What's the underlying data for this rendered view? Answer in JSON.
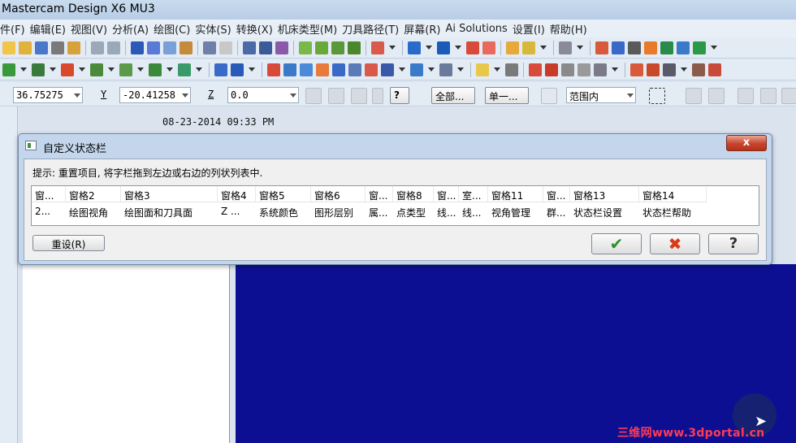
{
  "app": {
    "title": "Mastercam Design X6 MU3"
  },
  "menu": [
    "件(F)",
    "编辑(E)",
    "视图(V)",
    "分析(A)",
    "绘图(C)",
    "实体(S)",
    "转换(X)",
    "机床类型(M)",
    "刀具路径(T)",
    "屏幕(R)",
    "Ai Solutions",
    "设置(I)",
    "帮助(H)"
  ],
  "coords": {
    "x_value": "36.75275",
    "y_label": "Y",
    "y_value": "-20.41258",
    "z_label": "Z",
    "z_value": "0.0",
    "all_button": "全部...",
    "single_button": "单一...",
    "range_value": "范围内"
  },
  "status": {
    "datetime": "08-23-2014 09:33 PM"
  },
  "dialog": {
    "title": "自定义状态栏",
    "close_label": "x",
    "hint": "提示: 重置项目, 将字栏拖到左边或右边的列状列表中.",
    "columns": [
      "窗...",
      "窗格2",
      "窗格3",
      "窗格4",
      "窗格5",
      "窗格6",
      "窗...",
      "窗格8",
      "窗...",
      "室...",
      "窗格11",
      "窗...",
      "窗格13",
      "窗格14"
    ],
    "row": [
      "2...",
      "绘图视角",
      "绘图面和刀具面",
      "Z ...",
      "系统颜色",
      "图形层别",
      "属...",
      "点类型",
      "线...",
      "线...",
      "视角管理",
      "群...",
      "状态栏设置",
      "状态栏帮助"
    ],
    "reset_button": "重设(R)",
    "ok_icon": "check-icon",
    "cancel_icon": "cancel-x-icon",
    "help_icon": "help-icon"
  },
  "watermark": "三维网www.3dportal.cn"
}
